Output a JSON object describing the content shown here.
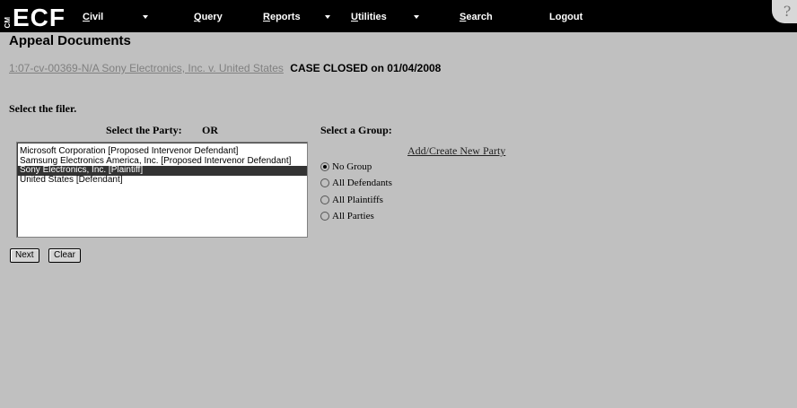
{
  "app": {
    "logo_small": "CM",
    "logo_main": "ECF"
  },
  "nav": {
    "items": [
      {
        "label_ul": "C",
        "label_rest": "ivil",
        "has_caret": true
      },
      {
        "label_ul": "Q",
        "label_rest": "uery",
        "has_caret": false
      },
      {
        "label_ul": "R",
        "label_rest": "eports",
        "has_caret": true
      },
      {
        "label_ul": "U",
        "label_rest": "tilities",
        "has_caret": true
      },
      {
        "label_ul": "S",
        "label_rest": "earch",
        "has_caret": false
      },
      {
        "label_ul": "",
        "label_rest": "Logout",
        "has_caret": false
      }
    ],
    "help_icon": "help-icon",
    "help_glyph": "?"
  },
  "page": {
    "title": "Appeal Documents",
    "case_link": "1:07-cv-00369-N/A Sony Electronics, Inc. v. United States",
    "case_status": "CASE CLOSED on 01/04/2008"
  },
  "form": {
    "select_filer": "Select the filer.",
    "select_party": "Select the Party:",
    "or": "OR",
    "select_group": "Select a Group:",
    "parties": [
      {
        "label": "Microsoft Corporation [Proposed Intervenor Defendant]",
        "selected": false
      },
      {
        "label": "Samsung Electronics America, Inc. [Proposed Intervenor Defendant]",
        "selected": false
      },
      {
        "label": "Sony Electronics, Inc. [Plaintiff]",
        "selected": true
      },
      {
        "label": "United States [Defendant]",
        "selected": false
      }
    ],
    "add_party_link": "Add/Create New Party",
    "groups": [
      {
        "label": "No Group",
        "checked": true
      },
      {
        "label": "All Defendants",
        "checked": false
      },
      {
        "label": "All Plaintiffs",
        "checked": false
      },
      {
        "label": "All Parties",
        "checked": false
      }
    ],
    "next_label": "Next",
    "clear_label": "Clear"
  }
}
